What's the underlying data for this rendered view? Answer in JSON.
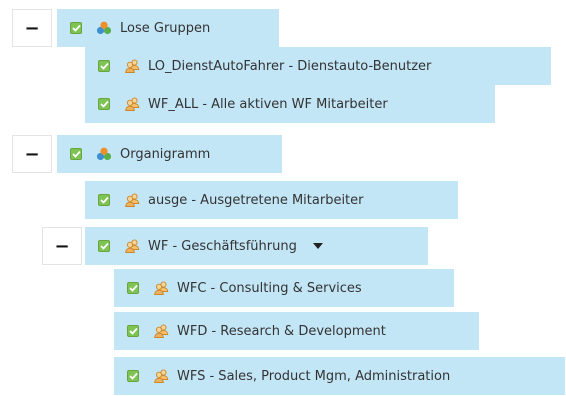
{
  "tree": {
    "expanded_symbol": "−",
    "colors": {
      "node_bg": "#c3e6f7",
      "checkbox": "#7dc453",
      "text": "#333333"
    },
    "nodes": [
      {
        "label": "Lose Gruppen",
        "icon": "group-category-icon",
        "expanded": true,
        "checked": true
      },
      {
        "label": "LO_DienstAutoFahrer - Dienstauto-Benutzer",
        "icon": "users-group-icon",
        "checked": true
      },
      {
        "label": "WF_ALL - Alle aktiven WF Mitarbeiter",
        "icon": "users-group-icon",
        "checked": true
      },
      {
        "label": "Organigramm",
        "icon": "group-category-icon",
        "expanded": true,
        "checked": true
      },
      {
        "label": "ausge - Ausgetretene Mitarbeiter",
        "icon": "users-group-icon",
        "checked": true
      },
      {
        "label": "WF - Geschäftsführung",
        "icon": "users-group-icon",
        "expanded": true,
        "checked": true,
        "has_dropdown": true
      },
      {
        "label": "WFC - Consulting & Services",
        "icon": "users-group-icon",
        "checked": true
      },
      {
        "label": "WFD - Research & Development",
        "icon": "users-group-icon",
        "checked": true
      },
      {
        "label": "WFS - Sales, Product Mgm, Administration",
        "icon": "users-group-icon",
        "checked": true
      }
    ]
  }
}
